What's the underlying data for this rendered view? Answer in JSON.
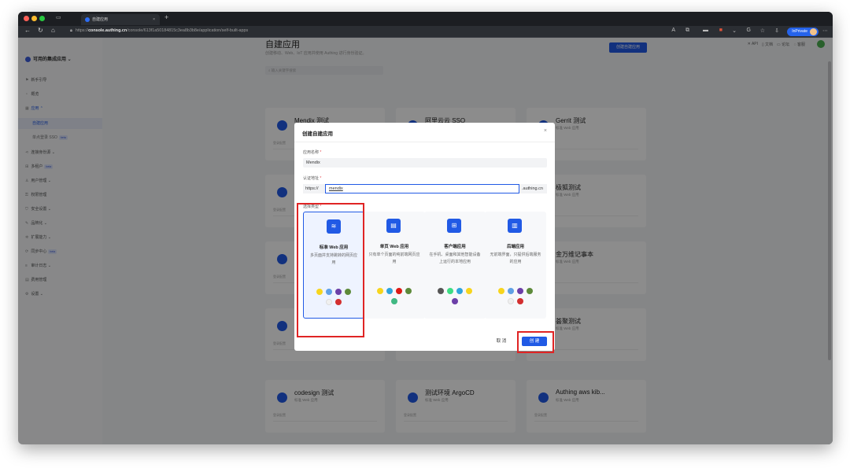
{
  "browser": {
    "tab_title": "自建应用",
    "url_prefix": "https://",
    "url_host": "console.authing.cn",
    "url_path": "/console/613f1a50184815c3ea8b3b8e/application/self-built-apps",
    "inprivate_label": "InPrivate"
  },
  "header": {
    "links": [
      "API",
      "文档",
      "论坛",
      "客服"
    ]
  },
  "sidebar": {
    "app_selector": "可用的集成应用",
    "items": [
      {
        "label": "新手引导",
        "icon": "flag-icon"
      },
      {
        "label": "概览",
        "icon": "dashboard-icon"
      },
      {
        "label": "应用",
        "icon": "apps-icon"
      },
      {
        "label": "自建应用",
        "sub": true,
        "active": true
      },
      {
        "label": "单点登录 SSO",
        "sub": true,
        "beta": "beta"
      },
      {
        "label": "连接身份源",
        "icon": "connect-icon"
      },
      {
        "label": "多租户",
        "icon": "tenant-icon",
        "beta": "beta"
      },
      {
        "label": "用户管理",
        "icon": "user-icon"
      },
      {
        "label": "权限管理",
        "icon": "key-icon"
      },
      {
        "label": "安全设置",
        "icon": "shield-icon"
      },
      {
        "label": "品牌化",
        "icon": "brand-icon"
      },
      {
        "label": "扩展能力",
        "icon": "extend-icon"
      },
      {
        "label": "同步中心",
        "icon": "sync-icon",
        "beta": "beta"
      },
      {
        "label": "审计日志",
        "icon": "log-icon"
      },
      {
        "label": "费用管理",
        "icon": "billing-icon"
      },
      {
        "label": "设置",
        "icon": "gear-icon"
      }
    ]
  },
  "main": {
    "title": "自建应用",
    "subtitle": "创建移动、Web、IoT 应用并使用 Authing 进行身份验证。",
    "create_button": "创建自建应用",
    "search_placeholder": "输入关键字搜索",
    "cards": [
      {
        "name": "Mendix 测试",
        "type": "标准 Web 应用",
        "foot": "登录配置"
      },
      {
        "name": "阿里云云 SSO",
        "type": "",
        "foot": ""
      },
      {
        "name": "Gerrit 测试",
        "type": "标准 Web 应用",
        "foot": ""
      },
      {
        "name": "",
        "type": "",
        "foot": "登录配置"
      },
      {
        "name": "",
        "type": "",
        "foot": ""
      },
      {
        "name": "极狐测试",
        "type": "标准 Web 应用",
        "foot": ""
      },
      {
        "name": "",
        "type": "",
        "foot": "登录配置"
      },
      {
        "name": "",
        "type": "",
        "foot": ""
      },
      {
        "name": "金万维记事本",
        "type": "标准 Web 应用",
        "foot": ""
      },
      {
        "name": "",
        "type": "",
        "foot": "登录配置"
      },
      {
        "name": "",
        "type": "",
        "foot": ""
      },
      {
        "name": "荟聚测试",
        "type": "标准 Web 应用",
        "foot": ""
      },
      {
        "name": "codesign 测试",
        "type": "标准 Web 应用",
        "foot": "登录配置"
      },
      {
        "name": "测试环境 ArgoCD",
        "type": "标准 Web 应用",
        "foot": "登录配置"
      },
      {
        "name": "Authing aws kib...",
        "type": "标准 Web 应用",
        "foot": "登录配置"
      }
    ]
  },
  "modal": {
    "title": "创建自建应用",
    "name_label": "应用名称",
    "name_value": "Mendix",
    "auth_label": "认证地址",
    "auth_prefix": "https://",
    "auth_value": "mendix",
    "auth_suffix": ".authing.cn",
    "type_label": "选择类型",
    "types": [
      {
        "name": "标准 Web 应用",
        "desc": "多页面并支持跳转的网页应用",
        "icon": "web-app-icon",
        "selected": true
      },
      {
        "name": "单页 Web 应用",
        "desc": "只有单个页面的纯前端网页应用",
        "icon": "spa-icon",
        "selected": false
      },
      {
        "name": "客户端应用",
        "desc": "在手机、桌面和其他智能设备上运行的本地应用",
        "icon": "client-app-icon",
        "selected": false
      },
      {
        "name": "后端应用",
        "desc": "无前端界面，只提供后端服务的应用",
        "icon": "backend-icon",
        "selected": false
      }
    ],
    "cancel_label": "取 消",
    "create_label": "创 建"
  },
  "colors": {
    "accent": "#215ae5",
    "highlight": "#e02424"
  }
}
